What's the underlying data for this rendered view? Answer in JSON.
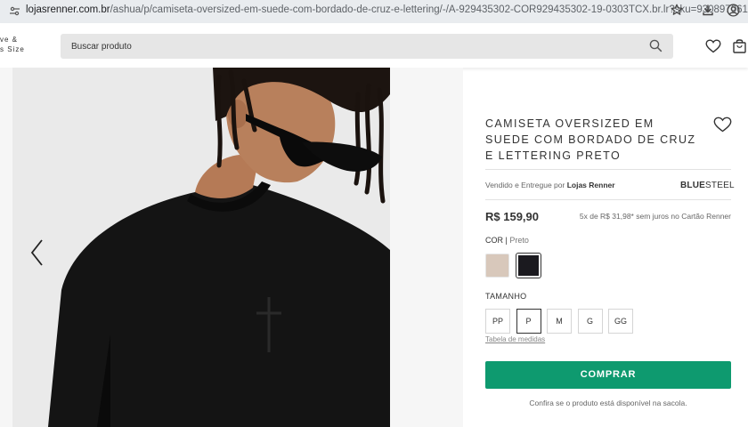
{
  "browser": {
    "url_host": "lojasrenner.com.br",
    "url_path": "/ashua/p/camiseta-oversized-em-suede-com-bordado-de-cruz-e-lettering/-/A-929435302-COR929435302-19-0303TCX.br.lr?sku=930897061"
  },
  "header": {
    "brand_line1": "ve &",
    "brand_line2": "s Size",
    "search_placeholder": "Buscar produto"
  },
  "product": {
    "title": "CAMISETA OVERSIZED EM SUEDE COM BORDADO DE CRUZ E LETTERING PRETO",
    "seller_prefix": "Vendido e Entregue por",
    "seller_name": "Lojas Renner",
    "brand_bold": "BLUE",
    "brand_light": "STEEL",
    "price": "R$ 159,90",
    "installments": "5x de R$ 31,98* sem juros no Cartão Renner",
    "color_label": "COR",
    "color_selected": "Preto",
    "colors": [
      "#d8c8bb",
      "#1b1a1f"
    ],
    "size_label": "TAMANHO",
    "sizes": [
      "PP",
      "P",
      "M",
      "G",
      "GG"
    ],
    "selected_size": "P",
    "size_table_link": "Tabela de medidas",
    "buy_button": "COMPRAR",
    "confirm_note": "Confira se o produto está disponível na sacola."
  }
}
